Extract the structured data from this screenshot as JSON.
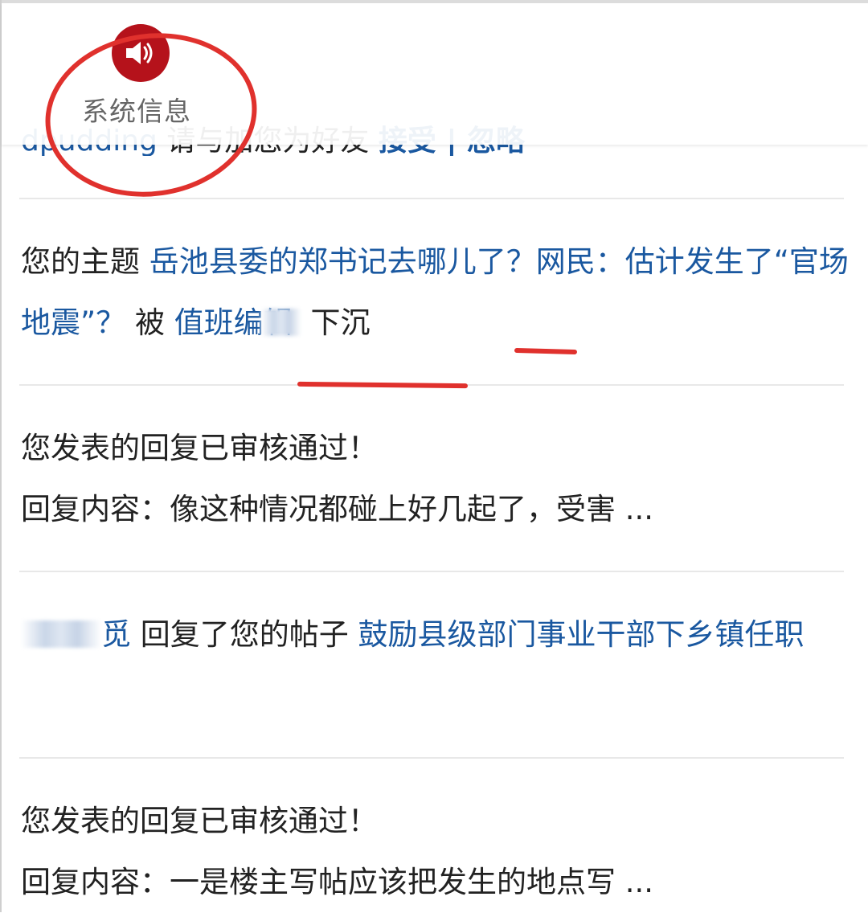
{
  "header": {
    "icon": "speaker-notice-icon",
    "label": "系统信息",
    "accent_color": "#b5121b"
  },
  "clipped_item": {
    "user": "dpudding",
    "text": "请与加您为好友",
    "action": "接受 | 忽略"
  },
  "items": [
    {
      "prefix": "您的主题",
      "link": "岳池县委的郑书记去哪儿了？网民：估计发生了“官场地震”？",
      "by": "被",
      "editor": "值班编辑",
      "action": "下沉"
    },
    {
      "line1": "您发表的回复已审核通过！",
      "line2": "回复内容：像这种情况都碰上好几起了，受害 ..."
    },
    {
      "user": "觅",
      "text": "回复了您的帖子",
      "link": "鼓励县级部门事业干部下乡镇任职"
    },
    {
      "line1": "您发表的回复已审核通过！",
      "line2": "回复内容：一是楼主写帖应该把发生的地点写 ..."
    }
  ],
  "colors": {
    "link": "#1a58a0",
    "annotation": "#e0312d",
    "divider": "#e8e8e8"
  }
}
